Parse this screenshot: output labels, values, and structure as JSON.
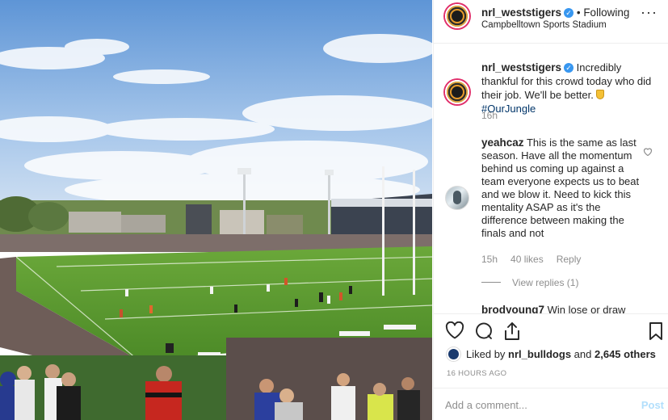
{
  "header": {
    "username": "nrl_weststigers",
    "follow_label": "Following",
    "separator": "•",
    "location": "Campbelltown Sports Stadium",
    "more_icon": "ellipsis-icon"
  },
  "caption": {
    "username": "nrl_weststigers",
    "text": "Incredibly thankful for this crowd today who did their job. We'll be better.",
    "hashtag": "#OurJungle",
    "time": "16h"
  },
  "comment": {
    "username": "yeahcaz",
    "text": "This is the same as last season. Have all the momentum behind us coming up against a team everyone expects us to beat and we blow it. Need to kick this mentality ASAP as it's the difference between making the finals and not",
    "time": "15h",
    "likes": "40 likes",
    "reply_label": "Reply",
    "view_replies": "View replies (1)"
  },
  "next_comment": {
    "username": "brodyoung7",
    "text_start": "Win lose or draw"
  },
  "actions": {
    "like_icon": "heart-icon",
    "comment_icon": "comment-icon",
    "share_icon": "share-icon",
    "save_icon": "bookmark-icon"
  },
  "likes": {
    "prefix": "Liked by",
    "user": "nrl_bulldogs",
    "and": "and",
    "others": "2,645 others"
  },
  "posted": "16 HOURS AGO",
  "add_comment": {
    "placeholder": "Add a comment...",
    "post_label": "Post"
  },
  "colors": {
    "verified": "#3897f0",
    "hashtag": "#003569",
    "muted": "#8e8e8e",
    "post_disabled": "#b2dffc"
  }
}
